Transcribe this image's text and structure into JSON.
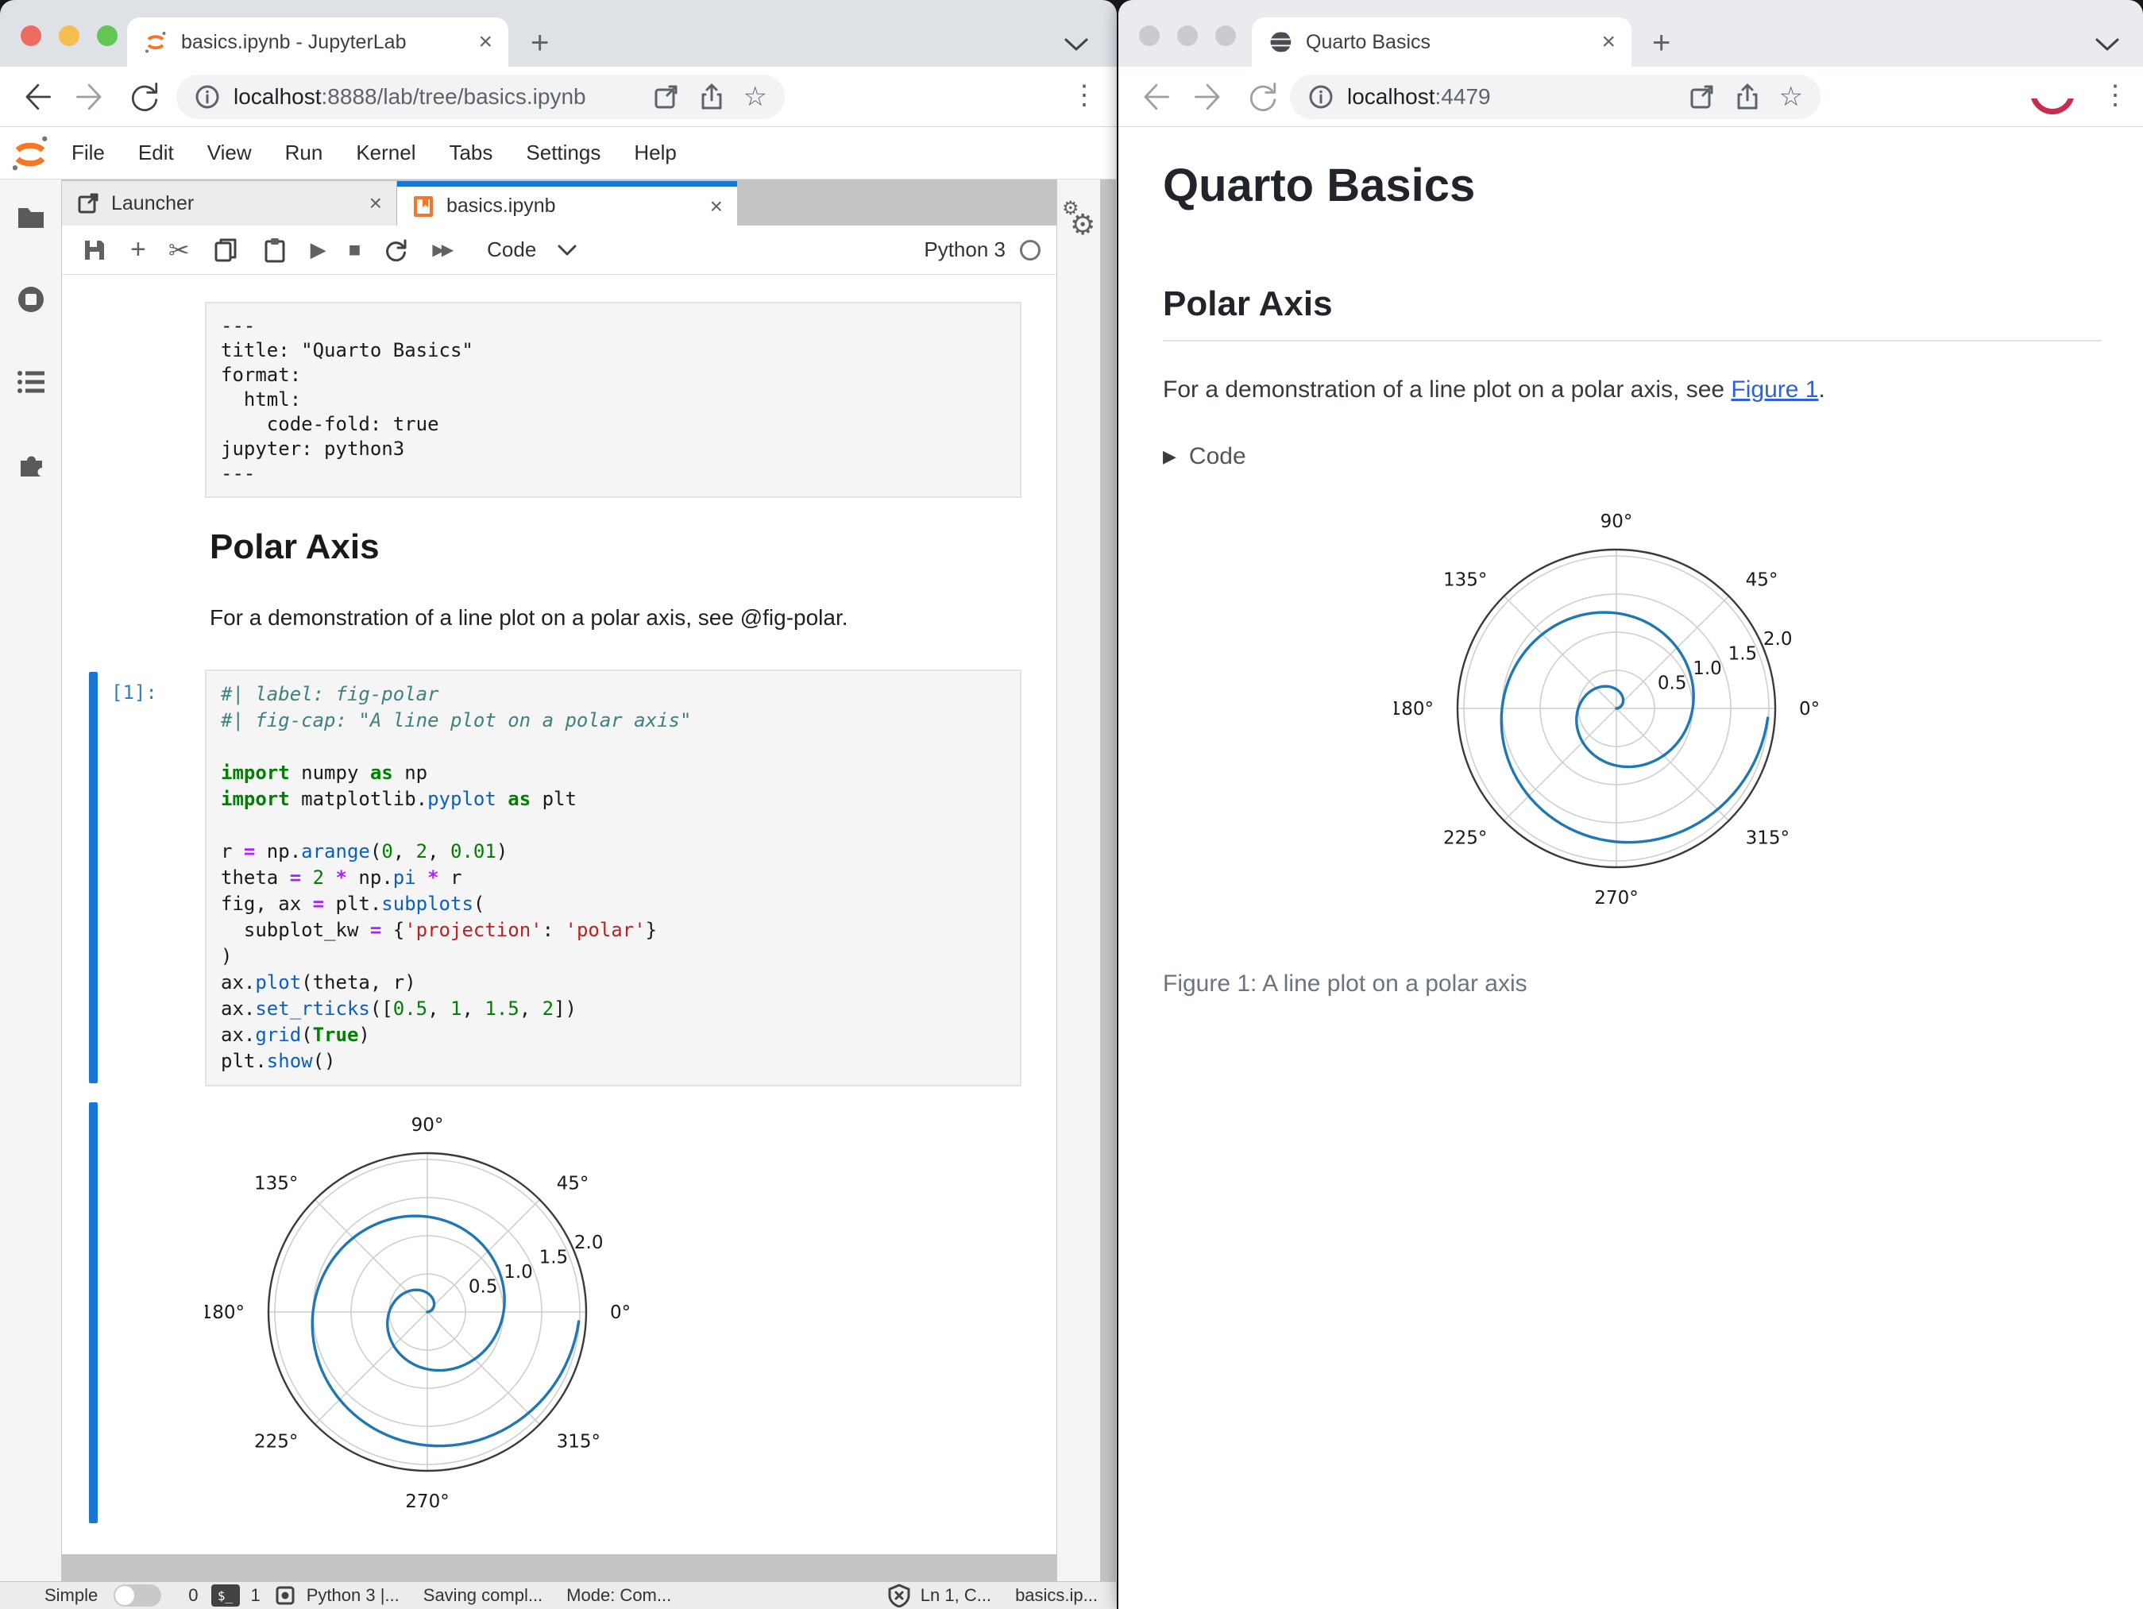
{
  "icons": {
    "close": "×",
    "plus": "+",
    "dots": "⋮",
    "star": "☆",
    "run": "▶",
    "stop": "■",
    "ffwd": "▶▶",
    "scissors": "✂",
    "gear": "⚙",
    "terminal": "$_",
    "details_triangle": "▶"
  },
  "left_window": {
    "tab_title": "basics.ipynb - JupyterLab",
    "url_host": "localhost",
    "url_rest": ":8888/lab/tree/basics.ipynb",
    "menu_items": [
      "File",
      "Edit",
      "View",
      "Run",
      "Kernel",
      "Tabs",
      "Settings",
      "Help"
    ],
    "dock_tabs": {
      "launcher": "Launcher",
      "notebook": "basics.ipynb"
    },
    "toolbar": {
      "cell_type": "Code",
      "kernel_name": "Python 3"
    },
    "notebook": {
      "yaml_cell_lines": [
        "---",
        "title: \"Quarto Basics\"",
        "format:",
        "  html:",
        "    code-fold: true",
        "jupyter: python3",
        "---"
      ],
      "heading": "Polar Axis",
      "paragraph": "For a demonstration of a line plot on a polar axis, see @fig-polar.",
      "code_prompt": "[1]:",
      "code_lines": [
        [
          [
            "cmt",
            "#| label: fig-polar"
          ]
        ],
        [
          [
            "cmt",
            "#| fig-cap: \"A line plot on a polar axis\""
          ]
        ],
        [],
        [
          [
            "kw",
            "import"
          ],
          [
            "pl",
            " numpy "
          ],
          [
            "kw",
            "as"
          ],
          [
            "pl",
            " np"
          ]
        ],
        [
          [
            "kw",
            "import"
          ],
          [
            "pl",
            " matplotlib."
          ],
          [
            "prop",
            "pyplot"
          ],
          [
            "pl",
            " "
          ],
          [
            "kw",
            "as"
          ],
          [
            "pl",
            " plt"
          ]
        ],
        [],
        [
          [
            "pl",
            "r "
          ],
          [
            "op",
            "="
          ],
          [
            "pl",
            " np."
          ],
          [
            "prop",
            "arange"
          ],
          [
            "pl",
            "("
          ],
          [
            "num",
            "0"
          ],
          [
            "pl",
            ", "
          ],
          [
            "num",
            "2"
          ],
          [
            "pl",
            ", "
          ],
          [
            "num",
            "0.01"
          ],
          [
            "pl",
            ")"
          ]
        ],
        [
          [
            "pl",
            "theta "
          ],
          [
            "op",
            "="
          ],
          [
            "pl",
            " "
          ],
          [
            "num",
            "2"
          ],
          [
            "pl",
            " "
          ],
          [
            "op",
            "*"
          ],
          [
            "pl",
            " np."
          ],
          [
            "prop",
            "pi"
          ],
          [
            "pl",
            " "
          ],
          [
            "op",
            "*"
          ],
          [
            "pl",
            " r"
          ]
        ],
        [
          [
            "pl",
            "fig, ax "
          ],
          [
            "op",
            "="
          ],
          [
            "pl",
            " plt."
          ],
          [
            "prop",
            "subplots"
          ],
          [
            "pl",
            "("
          ]
        ],
        [
          [
            "pl",
            "  subplot_kw "
          ],
          [
            "op",
            "="
          ],
          [
            "pl",
            " {"
          ],
          [
            "str",
            "'projection'"
          ],
          [
            "pl",
            ": "
          ],
          [
            "str",
            "'polar'"
          ],
          [
            "pl",
            "}"
          ]
        ],
        [
          [
            "pl",
            ")"
          ]
        ],
        [
          [
            "pl",
            "ax."
          ],
          [
            "prop",
            "plot"
          ],
          [
            "pl",
            "(theta, r)"
          ]
        ],
        [
          [
            "pl",
            "ax."
          ],
          [
            "prop",
            "set_rticks"
          ],
          [
            "pl",
            "(["
          ],
          [
            "num",
            "0.5"
          ],
          [
            "pl",
            ", "
          ],
          [
            "num",
            "1"
          ],
          [
            "pl",
            ", "
          ],
          [
            "num",
            "1.5"
          ],
          [
            "pl",
            ", "
          ],
          [
            "num",
            "2"
          ],
          [
            "pl",
            "])"
          ]
        ],
        [
          [
            "pl",
            "ax."
          ],
          [
            "prop",
            "grid"
          ],
          [
            "pl",
            "("
          ],
          [
            "kw",
            "True"
          ],
          [
            "pl",
            ")"
          ]
        ],
        [
          [
            "pl",
            "plt."
          ],
          [
            "prop",
            "show"
          ],
          [
            "pl",
            "()"
          ]
        ]
      ]
    },
    "status_bar": {
      "simple_label": "Simple",
      "terminal_count": "0",
      "kernel_count": "1",
      "kernel_status": "Python 3 |...",
      "saving_status": "Saving compl...",
      "mode": "Mode: Com...",
      "line_col": "Ln 1, C...",
      "filename": "basics.ip..."
    }
  },
  "right_window": {
    "tab_title": "Quarto Basics",
    "url_host": "localhost",
    "url_rest": ":4479",
    "page": {
      "title": "Quarto Basics",
      "section_heading": "Polar Axis",
      "paragraph_prefix": "For a demonstration of a line plot on a polar axis, see ",
      "link_text": "Figure 1",
      "paragraph_suffix": ".",
      "code_toggle_label": "Code",
      "figure_caption": "Figure 1: A line plot on a polar axis"
    }
  },
  "chart_data": {
    "type": "line",
    "projection": "polar",
    "description": "Archimedean spiral r from 0 to 2, theta = 2*pi*r (two full counterclockwise turns)",
    "r_min": 0,
    "r_max": 2,
    "r_step": 0.01,
    "rlim": [
      0,
      2
    ],
    "rticks": [
      0.5,
      1,
      1.5,
      2
    ],
    "rtick_labels": [
      "0.5",
      "1.0",
      "1.5",
      "2.0"
    ],
    "rlabel_angle_deg": 22.5,
    "theta_ticks_deg": [
      0,
      45,
      90,
      135,
      180,
      225,
      270,
      315
    ],
    "theta_tick_labels": [
      "0°",
      "45°",
      "90°",
      "135°",
      "180°",
      "225°",
      "270°",
      "315°"
    ],
    "grid": true,
    "line_color": "#1f77b4",
    "spine_color": "#3a3a3a",
    "grid_color": "#cfcfcf",
    "label_color": "#1a1a1a"
  }
}
